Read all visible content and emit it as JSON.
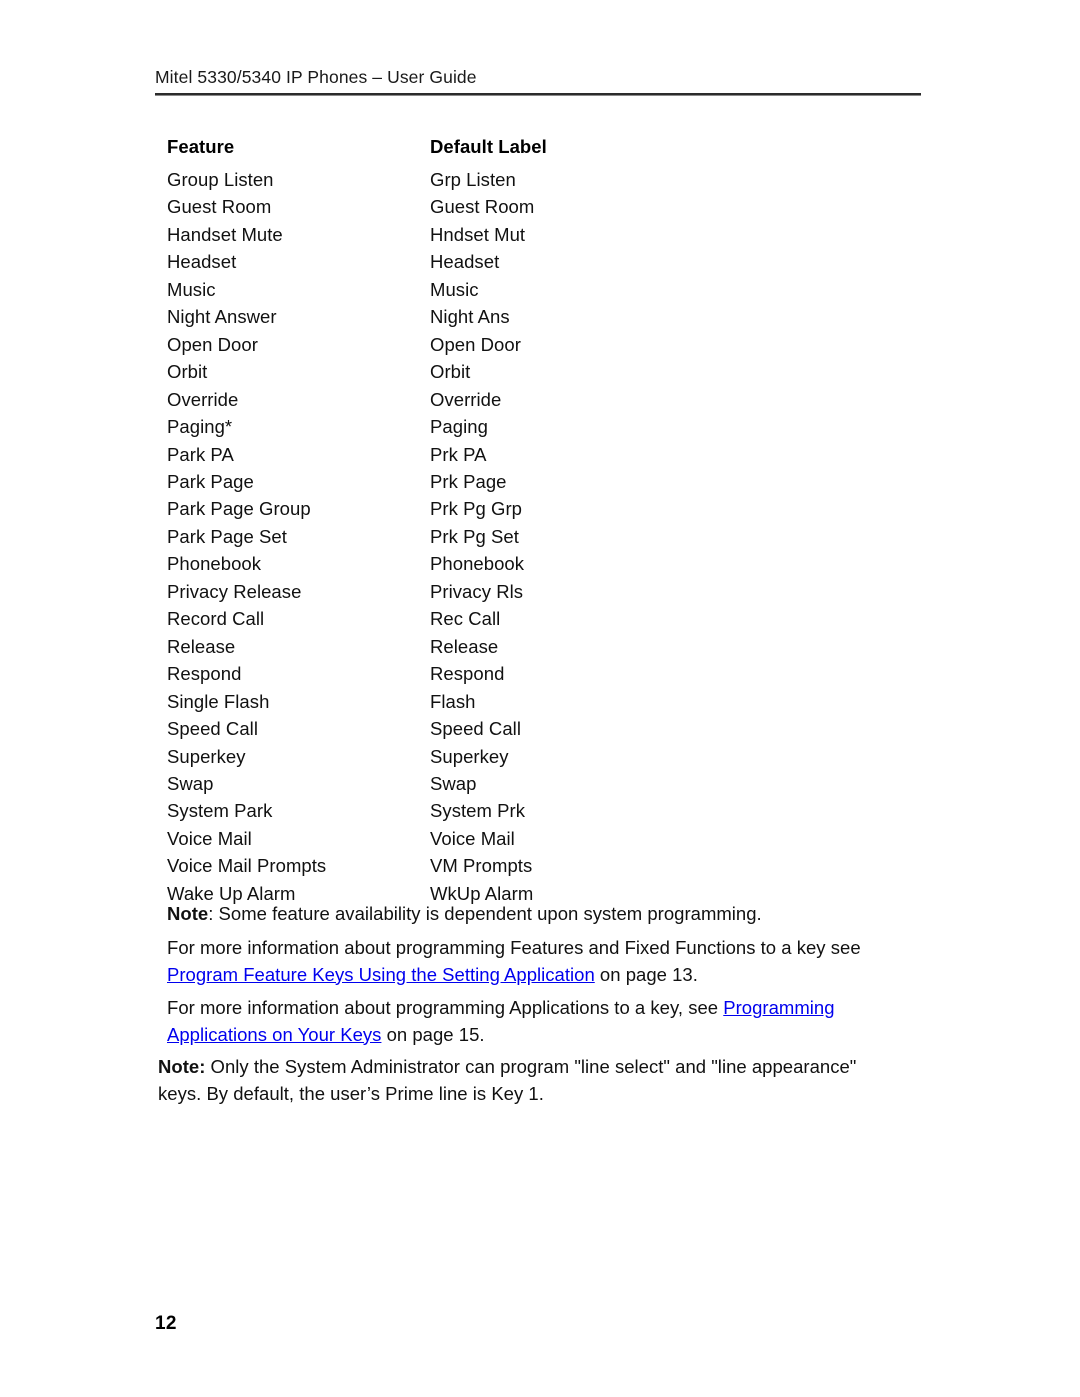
{
  "document": {
    "header_title": "Mitel 5330/5340 IP Phones – User Guide",
    "page_number": "12"
  },
  "table": {
    "headers": {
      "feature": "Feature",
      "default_label": "Default Label"
    },
    "rows": [
      {
        "feature": "Group Listen",
        "label": "Grp Listen"
      },
      {
        "feature": "Guest Room",
        "label": "Guest Room"
      },
      {
        "feature": "Handset Mute",
        "label": "Hndset Mut"
      },
      {
        "feature": "Headset",
        "label": "Headset"
      },
      {
        "feature": "Music",
        "label": "Music"
      },
      {
        "feature": "Night Answer",
        "label": "Night Ans"
      },
      {
        "feature": "Open Door",
        "label": "Open Door"
      },
      {
        "feature": "Orbit",
        "label": "Orbit"
      },
      {
        "feature": "Override",
        "label": "Override"
      },
      {
        "feature": "Paging*",
        "label": "Paging"
      },
      {
        "feature": "Park PA",
        "label": "Prk PA"
      },
      {
        "feature": "Park Page",
        "label": "Prk Page"
      },
      {
        "feature": "Park Page Group",
        "label": "Prk Pg Grp"
      },
      {
        "feature": "Park Page Set",
        "label": "Prk Pg Set"
      },
      {
        "feature": "Phonebook",
        "label": "Phonebook"
      },
      {
        "feature": "Privacy Release",
        "label": "Privacy Rls"
      },
      {
        "feature": "Record Call",
        "label": "Rec Call"
      },
      {
        "feature": "Release",
        "label": "Release"
      },
      {
        "feature": "Respond",
        "label": "Respond"
      },
      {
        "feature": "Single Flash",
        "label": "Flash"
      },
      {
        "feature": "Speed Call",
        "label": "Speed Call"
      },
      {
        "feature": "Superkey",
        "label": "Superkey"
      },
      {
        "feature": "Swap",
        "label": "Swap"
      },
      {
        "feature": "System Park",
        "label": "System Prk"
      },
      {
        "feature": "Voice Mail",
        "label": "Voice Mail"
      },
      {
        "feature": "Voice Mail Prompts",
        "label": "VM Prompts"
      },
      {
        "feature": "Wake Up Alarm",
        "label": "WkUp Alarm"
      }
    ]
  },
  "notes": {
    "note_one_label": "Note",
    "note_one_text": ": Some feature availability is dependent upon system programming.",
    "note_two_label": "Note:",
    "note_two_text": " Only the System Administrator can program \"line select\" and \"line appearance\" keys. By default, the user’s Prime line is Key 1."
  },
  "paragraphs": {
    "features_lead": "For more information about programming Features and Fixed Functions to a key see ",
    "features_link": "Program Feature Keys Using the Setting Application",
    "features_tail": " on page 13.",
    "apps_lead": "For more information about programming Applications to a key, see  ",
    "apps_link": "Programming Applications on Your Keys",
    "apps_tail": " on page 15."
  },
  "colors": {
    "link": "#0000EE",
    "text": "#111111",
    "rule": "#2B2B2B"
  }
}
